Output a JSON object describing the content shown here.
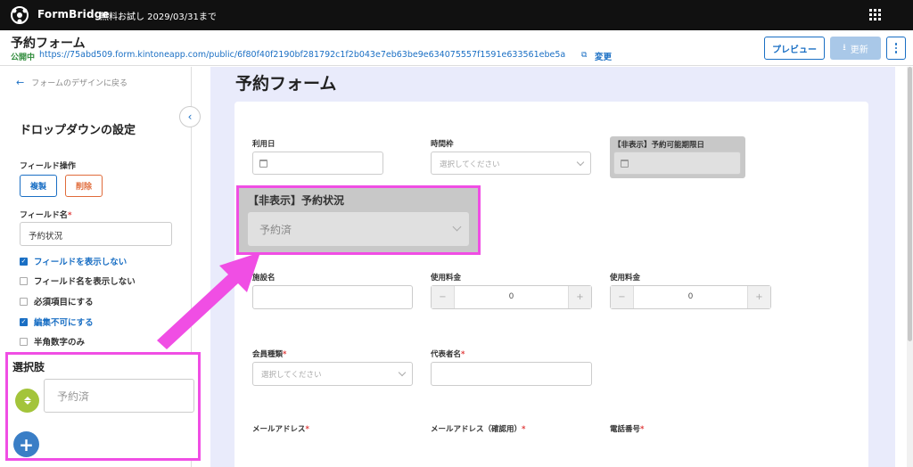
{
  "topbar": {
    "brand": "FormBridge",
    "trial": "無料お試し 2029/03/31まで"
  },
  "header": {
    "title": "予約フォーム",
    "status": "公開中",
    "url": "https://75abd509.form.kintoneapp.com/public/6f80f40f2190bf281792c1f2b043e7eb63be9e634075557f1591e633561ebe5a",
    "change_label": "変更",
    "preview_label": "プレビュー",
    "update_label": "更新"
  },
  "left_panel": {
    "back_label": "フォームのデザインに戻る",
    "title": "ドロップダウンの設定",
    "field_ops_label": "フィールド操作",
    "copy_label": "複製",
    "delete_label": "削除",
    "field_name_label": "フィールド名",
    "required_mark": "*",
    "field_name_value": "予約状況",
    "options": [
      {
        "label": "フィールドを表示しない",
        "checked": true
      },
      {
        "label": "フィールド名を表示しない",
        "checked": false
      },
      {
        "label": "必須項目にする",
        "checked": false
      },
      {
        "label": "編集不可にする",
        "checked": true
      },
      {
        "label": "半角数字のみ",
        "checked": false
      }
    ],
    "choices_title": "選択肢",
    "choice_value": "予約済"
  },
  "preview": {
    "title": "予約フォーム",
    "row1": {
      "date_label": "利用日",
      "time_label": "時間枠",
      "time_placeholder": "選択してください",
      "hidden_date_label": "【非表示】予約可能期限日"
    },
    "status_field": {
      "label": "【非表示】予約状況",
      "value": "予約済"
    },
    "row2": {
      "facility_label": "施設名",
      "fee1_label": "使用料金",
      "fee1_value": "0",
      "fee2_label": "使用料金",
      "fee2_value": "0",
      "minus": "−",
      "plus": "+"
    },
    "row3": {
      "member_label": "会員種類",
      "member_placeholder": "選択してください",
      "rep_label": "代表者名"
    },
    "row4": {
      "email_label": "メールアドレス",
      "email_confirm_label": "メールアドレス（確認用）",
      "phone_label": "電話番号"
    },
    "required_mark": "*"
  },
  "colors": {
    "accent": "#1a6fc4",
    "highlight": "#f04ee4",
    "preview_bg": "#e9ebfb",
    "public_status": "#2e8b3a"
  }
}
